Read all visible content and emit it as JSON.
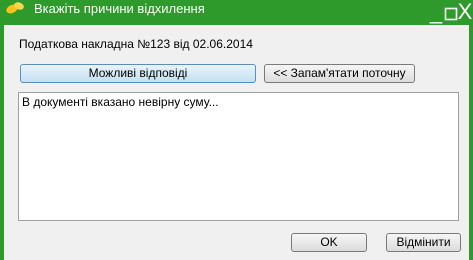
{
  "window": {
    "title": "Вкажіть причини відхилення",
    "minimize_glyph": "_",
    "maximize_glyph": "□",
    "close_glyph": "X",
    "app_icon": "leaf-icon",
    "colors": {
      "titlebar": "#2f9a2c",
      "body": "#f0f0f0",
      "title_text": "#ffffff"
    }
  },
  "document_label": "Податкова накладна  №123 від 02.06.2014",
  "buttons": {
    "possible_answers": "Можливі відповіді",
    "remember_current": "<< Запам'ятати поточну",
    "ok": "OK",
    "cancel": "Відмінити"
  },
  "reason_text": "В документі вказано невірну суму..."
}
